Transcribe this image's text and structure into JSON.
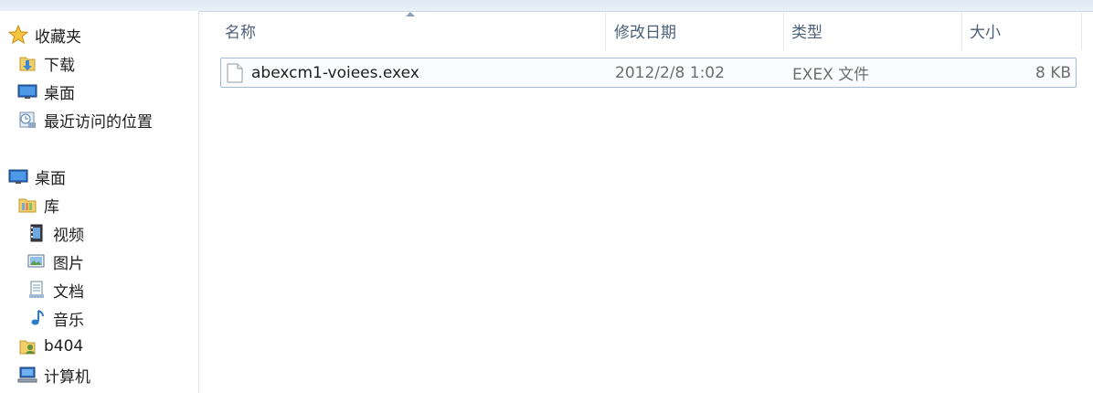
{
  "navigation": {
    "favorites_label": "收藏夹",
    "favorites": [
      "下载",
      "桌面",
      "最近访问的位置"
    ],
    "desktop_label": "桌面",
    "library_label": "库",
    "libraries": [
      "视频",
      "图片",
      "文档",
      "音乐"
    ],
    "user_label": "b404",
    "computer_label": "计算机"
  },
  "columns": {
    "name": "名称",
    "modified": "修改日期",
    "type": "类型",
    "size": "大小"
  },
  "files": [
    {
      "name": "abexcm1-voiees.exex",
      "modified": "2012/2/8 1:02",
      "type": "EXEX 文件",
      "size": "8 KB"
    }
  ],
  "colors": {
    "header_text": "#4c607a",
    "date_text": "#6d6d6d",
    "selection_border": "#a6b9d3"
  },
  "icons": [
    "star-icon",
    "downloads-folder-icon",
    "desktop-icon",
    "recent-places-icon",
    "library-icon",
    "video-icon",
    "picture-icon",
    "document-icon",
    "music-icon",
    "user-folder-icon",
    "computer-icon",
    "file-icon"
  ]
}
